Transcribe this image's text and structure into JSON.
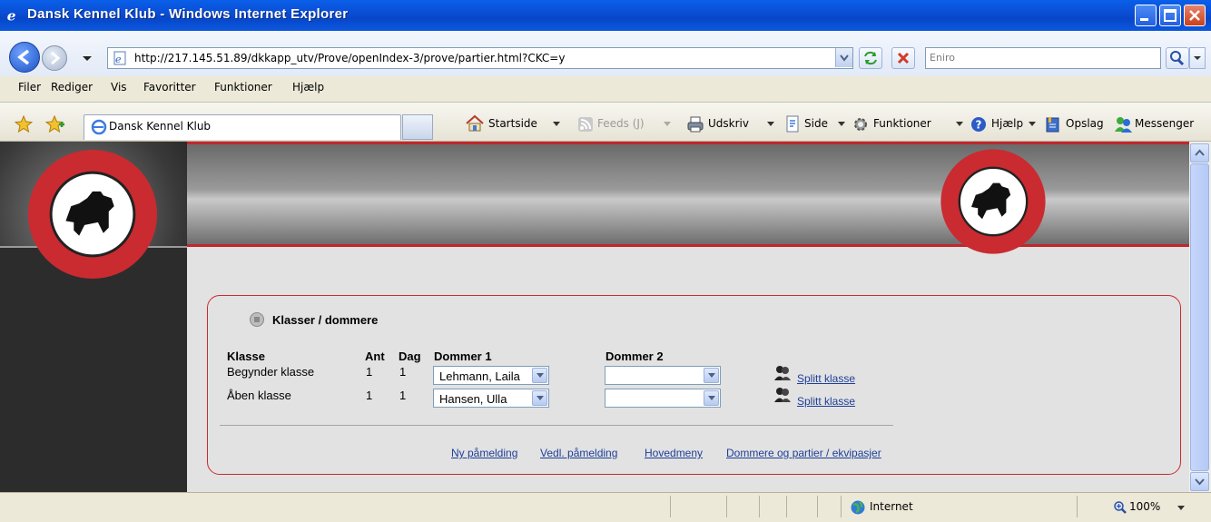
{
  "window": {
    "title": "Dansk Kennel Klub - Windows Internet Explorer"
  },
  "address": {
    "url": "http://217.145.51.89/dkkapp_utv/Prove/openIndex-3/prove/partier.html?CKC=y",
    "search_placeholder": "Eniro"
  },
  "menu": {
    "items": [
      "Filer",
      "Rediger",
      "Vis",
      "Favoritter",
      "Funktioner",
      "Hjælp"
    ]
  },
  "toolbar": {
    "tab_label": "Dansk Kennel Klub",
    "buttons": [
      "Startside",
      "Feeds (J)",
      "Udskriv",
      "Side",
      "Funktioner",
      "Hjælp",
      "Opslag",
      "Messenger"
    ]
  },
  "panel": {
    "title": "Klasser / dommere",
    "headers": {
      "klasse": "Klasse",
      "ant": "Ant",
      "dag": "Dag",
      "dommer1": "Dommer 1",
      "dommer2": "Dommer 2"
    },
    "rows": [
      {
        "klasse": "Begynder klasse",
        "ant": "1",
        "dag": "1",
        "dommer1": "Lehmann, Laila",
        "dommer2": "",
        "split": "Splitt klasse"
      },
      {
        "klasse": "Åben klasse",
        "ant": "1",
        "dag": "1",
        "dommer1": "Hansen, Ulla",
        "dommer2": "",
        "split": "Splitt klasse"
      }
    ],
    "links": [
      "Ny påmelding",
      "Vedl. påmelding",
      "Hovedmeny",
      "Dommere og partier / ekvipasjer"
    ]
  },
  "status": {
    "zone": "Internet",
    "zoom": "100%"
  },
  "colors": {
    "accent_red": "#c0282d",
    "link": "#1e3f99",
    "titlebar": "#0a4fd6"
  }
}
